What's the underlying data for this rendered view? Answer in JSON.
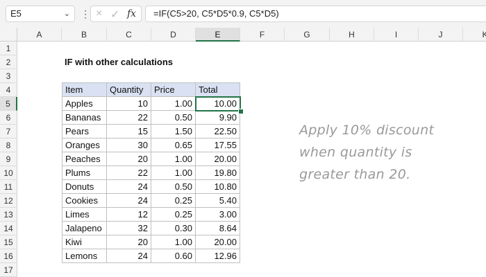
{
  "formula_bar": {
    "name_box": "E5",
    "fx_label": "fx",
    "cancel_icon": "×",
    "enter_icon": "✓",
    "formula": "=IF(C5>20, C5*D5*0.9, C5*D5)"
  },
  "columns": [
    "A",
    "B",
    "C",
    "D",
    "E",
    "F",
    "G",
    "H",
    "I",
    "J",
    "K"
  ],
  "rows": [
    "1",
    "2",
    "3",
    "4",
    "5",
    "6",
    "7",
    "8",
    "9",
    "10",
    "11",
    "12",
    "13",
    "14",
    "15",
    "16",
    "17"
  ],
  "selected_cell": "E5",
  "sheet": {
    "title": "IF with other calculations",
    "table_headers": [
      "Item",
      "Quantity",
      "Price",
      "Total"
    ],
    "table_rows": [
      [
        "Apples",
        "10",
        "1.00",
        "10.00"
      ],
      [
        "Bananas",
        "22",
        "0.50",
        "9.90"
      ],
      [
        "Pears",
        "15",
        "1.50",
        "22.50"
      ],
      [
        "Oranges",
        "30",
        "0.65",
        "17.55"
      ],
      [
        "Peaches",
        "20",
        "1.00",
        "20.00"
      ],
      [
        "Plums",
        "22",
        "1.00",
        "19.80"
      ],
      [
        "Donuts",
        "24",
        "0.50",
        "10.80"
      ],
      [
        "Cookies",
        "24",
        "0.25",
        "5.40"
      ],
      [
        "Limes",
        "12",
        "0.25",
        "3.00"
      ],
      [
        "Jalapeno",
        "32",
        "0.30",
        "8.64"
      ],
      [
        "Kiwi",
        "20",
        "1.00",
        "20.00"
      ],
      [
        "Lemons",
        "24",
        "0.60",
        "12.96"
      ]
    ],
    "note_lines": [
      "Apply 10% discount",
      "when quantity is",
      "greater than 20."
    ]
  },
  "colors": {
    "accent": "#217346",
    "header_fill": "#d9e1f2"
  }
}
